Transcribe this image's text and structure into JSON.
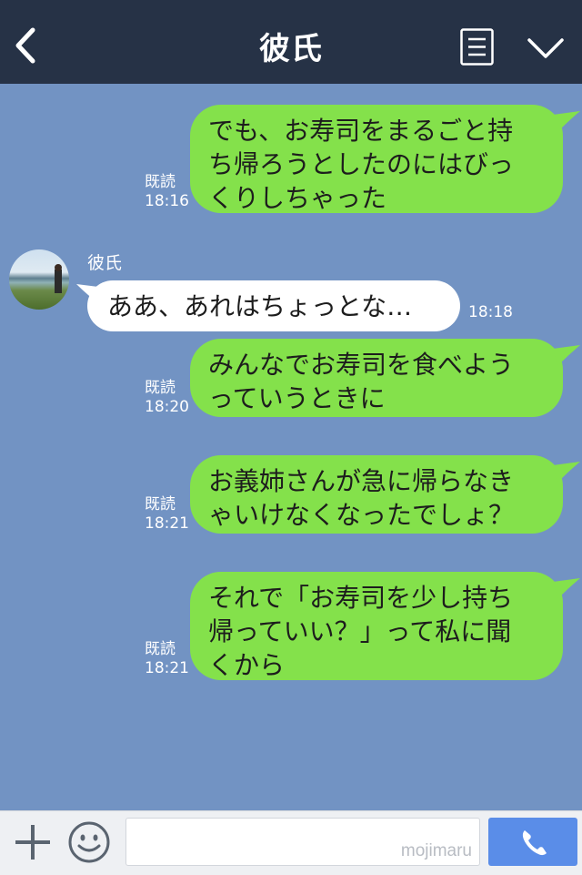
{
  "header": {
    "title": "彼氏",
    "back_icon": "chevron-left-icon",
    "menu_icon": "list-icon",
    "expand_icon": "chevron-down-icon",
    "background": "#263246"
  },
  "chat": {
    "background": "#7293c3",
    "messages": [
      {
        "direction": "outgoing",
        "text": "でも、お寿司をまるごと持\nち帰ろうとしたのにはびっ\nくりしちゃった",
        "read_label": "既読",
        "time": "18:16"
      },
      {
        "direction": "incoming",
        "sender": "彼氏",
        "text": "ああ、あれはちょっとな…",
        "time": "18:18"
      },
      {
        "direction": "outgoing",
        "text": "みんなでお寿司を食べよう\nっていうときに",
        "read_label": "既読",
        "time": "18:20"
      },
      {
        "direction": "outgoing",
        "text": "お義姉さんが急に帰らなき\nゃいけなくなったでしょ？",
        "read_label": "既読",
        "time": "18:21"
      },
      {
        "direction": "outgoing",
        "text": "それで「お寿司を少し持ち\n帰っていい？」って私に聞\nくから",
        "read_label": "既読",
        "time": "18:21"
      }
    ],
    "colors": {
      "outgoing_bubble": "#84e14b",
      "incoming_bubble": "#ffffff"
    }
  },
  "footer": {
    "plus_icon": "plus-icon",
    "emoji_icon": "smiley-icon",
    "input_value": "",
    "watermark": "mojimaru",
    "call_icon": "phone-icon",
    "call_color": "#5a8de8"
  }
}
